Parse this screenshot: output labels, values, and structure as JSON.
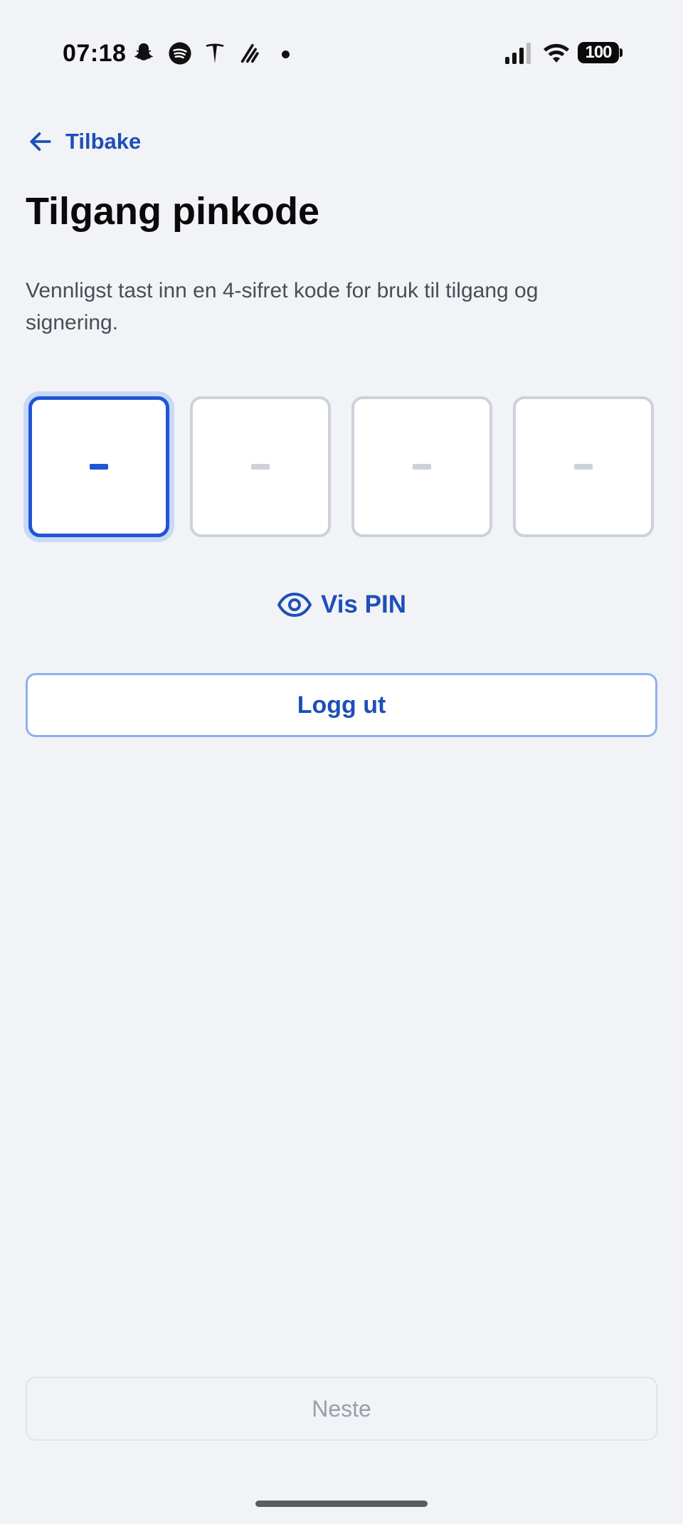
{
  "status_bar": {
    "time": "07:18",
    "notification_icons": [
      "snapchat-icon",
      "spotify-icon",
      "tesla-icon",
      "strava-icon"
    ],
    "battery": "100"
  },
  "nav": {
    "back_label": "Tilbake"
  },
  "page": {
    "title": "Tilgang pinkode",
    "description": "Vennligst tast inn en 4-sifret kode for bruk til tilgang og signering."
  },
  "pin": {
    "length": 4,
    "active_index": 0,
    "placeholder": "-"
  },
  "actions": {
    "show_pin_label": "Vis PIN",
    "logout_label": "Logg ut",
    "next_label": "Neste"
  },
  "colors": {
    "accent": "#1e4fb8",
    "active_border": "#1f55d6",
    "background": "#f1f3f7"
  }
}
